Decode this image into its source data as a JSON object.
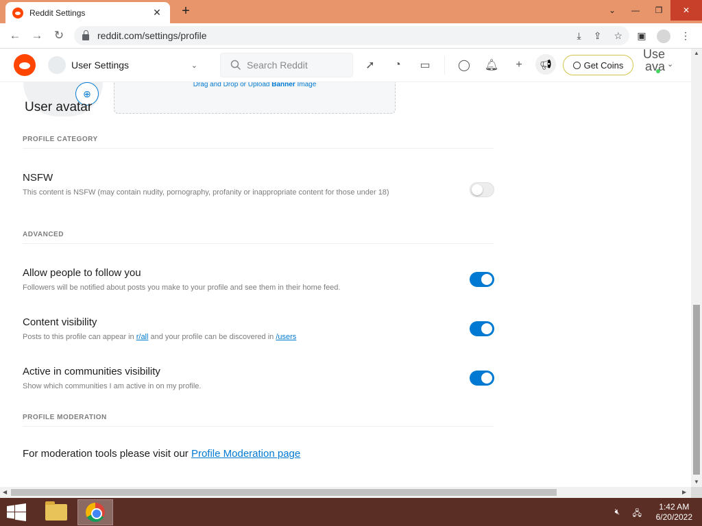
{
  "browser": {
    "tab_title": "Reddit Settings",
    "tab_close": "✕",
    "new_tab": "+",
    "url": "reddit.com/settings/profile",
    "win_minimize": "⌄",
    "win_restore": "❐",
    "win_close": "✕"
  },
  "header": {
    "home_label": "User Settings",
    "search_placeholder": "Search Reddit",
    "get_coins": "Get Coins",
    "user_line1": "Use",
    "user_line2": "ava"
  },
  "profile": {
    "avatar_label": "User avatar",
    "banner_hint_prefix": "Drag and Drop or Upload ",
    "banner_hint_bold": "Banner",
    "banner_hint_suffix": " Image"
  },
  "sections": {
    "category_head": "PROFILE CATEGORY",
    "advanced_head": "ADVANCED",
    "moderation_head": "PROFILE MODERATION"
  },
  "options": {
    "nsfw": {
      "title": "NSFW",
      "desc": "This content is NSFW (may contain nudity, pornography, profanity or inappropriate content for those under 18)",
      "enabled": false
    },
    "follow": {
      "title": "Allow people to follow you",
      "desc": "Followers will be notified about posts you make to your profile and see them in their home feed.",
      "enabled": true
    },
    "visibility": {
      "title": "Content visibility",
      "desc_prefix": "Posts to this profile can appear in ",
      "desc_link1": "r/all",
      "desc_middle": " and your profile can be discovered in ",
      "desc_link2": "/users",
      "enabled": true
    },
    "communities": {
      "title": "Active in communities visibility",
      "desc": "Show which communities I am active in on my profile.",
      "enabled": true
    }
  },
  "moderation": {
    "prefix": "For moderation tools please visit our ",
    "link": "Profile Moderation page"
  },
  "taskbar": {
    "time": "1:42 AM",
    "date": "6/20/2022"
  },
  "colors": {
    "accent": "#0079d3",
    "reddit_orange": "#ff4500",
    "titlebar": "#e8956b",
    "taskbar": "#5a2e24"
  }
}
